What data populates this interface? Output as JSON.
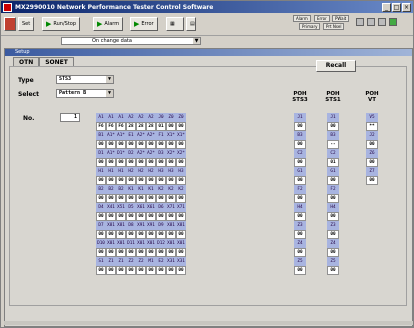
{
  "window": {
    "title": "MX2990010 Network Performance Tester Control Software"
  },
  "toolbar": {
    "set_label": "Set",
    "runstop_label": "Run/Stop",
    "alarm_label": "Alarm",
    "error_label": "Error",
    "rt_mini_1": "Alarm",
    "rt_mini_2": "Error",
    "rt_mini_3": "PWait",
    "rt_mini_4": "Primary",
    "rt_mini_5": "Prt Nsel"
  },
  "change_drop": {
    "value": "On change data"
  },
  "subwindow": {
    "title": "Setup"
  },
  "tabs": [
    {
      "label": "OTN"
    },
    {
      "label": "SONET"
    }
  ],
  "form": {
    "type_label": "Type",
    "type_value": "STS3",
    "select_label": "Select",
    "select_value": "Pattern B",
    "no_label": "No.",
    "no_value": "1"
  },
  "recall_label": "Recall",
  "poh_headers": {
    "sts3": "POH\nSTS3",
    "sts1": "POH\nSTS1",
    "vt": "POH\nVT"
  },
  "grid_rows": [
    {
      "h": [
        "A1",
        "A1",
        "A1",
        "A2",
        "A2",
        "A2",
        "J0",
        "Z0",
        "Z0"
      ],
      "v": [
        "F6",
        "F6",
        "F6",
        "28",
        "28",
        "28",
        "01",
        "00",
        "00"
      ]
    },
    {
      "h": [
        "B1",
        "A1*",
        "A1*",
        "E1",
        "A2*",
        "A2*",
        "F1",
        "X1*",
        "X1*"
      ],
      "v": [
        "00",
        "00",
        "00",
        "00",
        "00",
        "00",
        "00",
        "00",
        "00"
      ]
    },
    {
      "h": [
        "D1",
        "A1*",
        "D1*",
        "D2",
        "A2*",
        "A2*",
        "D3",
        "X2*",
        "X2*"
      ],
      "v": [
        "00",
        "00",
        "00",
        "00",
        "00",
        "00",
        "00",
        "00",
        "00"
      ]
    },
    {
      "h": [
        "H1",
        "H1",
        "H1",
        "H2",
        "H2",
        "H2",
        "H3",
        "H3",
        "H3"
      ],
      "v": [
        "00",
        "00",
        "00",
        "00",
        "00",
        "00",
        "00",
        "00",
        "00"
      ]
    },
    {
      "h": [
        "B2",
        "B2",
        "B2",
        "K1",
        "K1",
        "K1",
        "K2",
        "K2",
        "K2"
      ],
      "v": [
        "00",
        "00",
        "00",
        "00",
        "00",
        "00",
        "00",
        "00",
        "00"
      ]
    },
    {
      "h": [
        "D4",
        "X41",
        "X51",
        "D5",
        "X61",
        "X61",
        "D6",
        "X71",
        "X71"
      ],
      "v": [
        "00",
        "00",
        "00",
        "00",
        "00",
        "00",
        "00",
        "00",
        "00"
      ]
    },
    {
      "h": [
        "D7",
        "X81",
        "X81",
        "D8",
        "X91",
        "X91",
        "D9",
        "X81",
        "X81"
      ],
      "v": [
        "00",
        "00",
        "00",
        "00",
        "00",
        "00",
        "00",
        "00",
        "00"
      ]
    },
    {
      "h": [
        "D10",
        "X01",
        "X01",
        "D11",
        "X01",
        "X01",
        "D12",
        "X01",
        "X01"
      ],
      "v": [
        "00",
        "00",
        "00",
        "00",
        "00",
        "00",
        "00",
        "00",
        "00"
      ]
    },
    {
      "h": [
        "S1",
        "Z1",
        "Z1",
        "Z2",
        "Z2",
        "M1",
        "E2",
        "X31",
        "X31"
      ],
      "v": [
        "00",
        "00",
        "00",
        "00",
        "00",
        "00",
        "00",
        "00",
        "00"
      ]
    }
  ],
  "poh_sts3": [
    {
      "h": "J1",
      "v": "00"
    },
    {
      "h": "B3",
      "v": "00"
    },
    {
      "h": "C2",
      "v": "00"
    },
    {
      "h": "G1",
      "v": "00"
    },
    {
      "h": "F2",
      "v": "00"
    },
    {
      "h": "H4",
      "v": "00"
    },
    {
      "h": "Z3",
      "v": "00"
    },
    {
      "h": "Z4",
      "v": "00"
    },
    {
      "h": "Z5",
      "v": "00"
    }
  ],
  "poh_sts1": [
    {
      "h": "J1",
      "v": "00"
    },
    {
      "h": "B3",
      "v": "--"
    },
    {
      "h": "C2",
      "v": "01"
    },
    {
      "h": "G1",
      "v": "00"
    },
    {
      "h": "F2",
      "v": "00"
    },
    {
      "h": "H4",
      "v": "00"
    },
    {
      "h": "Z3",
      "v": "00"
    },
    {
      "h": "Z4",
      "v": "00"
    },
    {
      "h": "Z5",
      "v": "00"
    }
  ],
  "poh_vt": [
    {
      "h": "V5",
      "v": "**"
    },
    {
      "h": "J2",
      "v": "00"
    },
    {
      "h": "Z6",
      "v": "00"
    },
    {
      "h": "Z7",
      "v": "00"
    }
  ]
}
